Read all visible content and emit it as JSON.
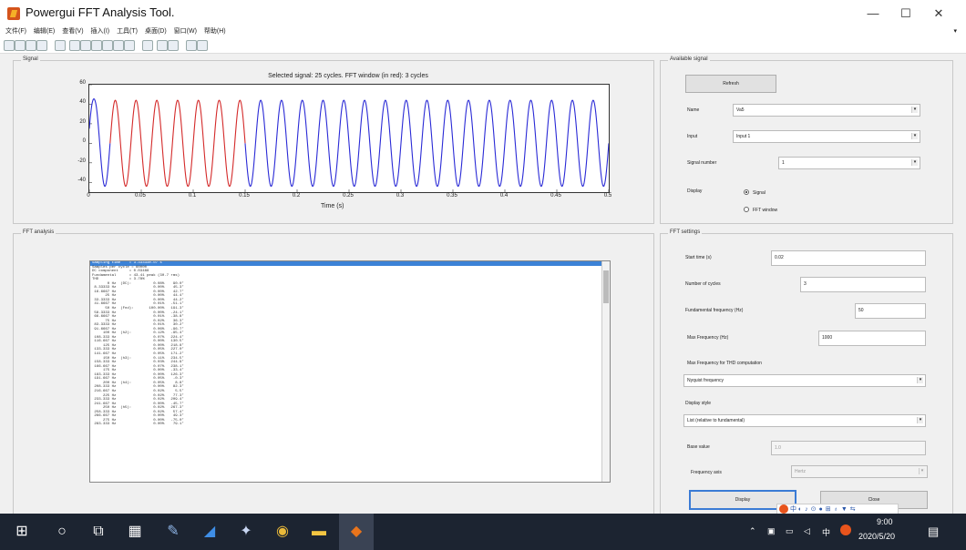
{
  "window": {
    "title": "Powergui FFT Analysis Tool.",
    "controls": [
      "—",
      "☐",
      "✕"
    ]
  },
  "menu": {
    "items": [
      "文件(F)",
      "编辑(E)",
      "查看(V)",
      "插入(I)",
      "工具(T)",
      "桌面(D)",
      "窗口(W)",
      "帮助(H)"
    ]
  },
  "signal_panel": {
    "title": "Signal"
  },
  "chart_data": {
    "type": "line",
    "title": "Selected signal: 25 cycles. FFT window (in red): 3 cycles",
    "xlabel": "Time (s)",
    "ylabel": "",
    "xlim": [
      0,
      0.5
    ],
    "ylim": [
      -50,
      60
    ],
    "xticks": [
      "0",
      "0.05",
      "0.1",
      "0.15",
      "0.2",
      "0.25",
      "0.3",
      "0.35",
      "0.4",
      "0.45",
      "0.5"
    ],
    "yticks": [
      "60",
      "40",
      "20",
      "0",
      "-20",
      "-40"
    ],
    "series": [
      {
        "color": "#d42a2a",
        "description_window": [
          0.02,
          0.15
        ]
      },
      {
        "color": "#2a2ad6"
      }
    ],
    "amplitude": 44,
    "frequency": 50,
    "initial_spike": 60
  },
  "fft_panel": {
    "title": "FFT analysis",
    "lines": [
      "Sampling time    = 3.33333e-07 s",
      "Samples per cycle = 60000",
      "DC component     = 0.03488",
      "Fundamental      = 43.41 peak (30.7 rms)",
      "THD              = 3.78%",
      "",
      "       0 Hz  (DC):          0.08%    90.0°",
      " 8.33333 Hz                 0.00%    45.3°",
      " 16.6667 Hz                 0.00%    42.7°",
      "      25 Hz                 0.00%    44.4°",
      " 33.3333 Hz                 0.00%    44.2°",
      " 41.6667 Hz                 0.01%   -51.1°",
      "      50 Hz  (Fnd):       100.00%   191.3°",
      " 58.3333 Hz                 0.00%   -24.1°",
      " 66.6667 Hz                 0.01%   -38.8°",
      "      75 Hz                 0.02%    36.3°",
      " 83.3333 Hz                 0.01%    30.2°",
      " 91.6667 Hz                 0.06%   -96.7°",
      "     100 Hz  (h2):          0.12%   -95.4°",
      " 108.333 Hz                 0.07%   224.4°",
      " 116.667 Hz                 0.00%   130.5°",
      "     125 Hz                 0.00%   218.8°",
      " 133.333 Hz                 0.05%   227.0°",
      " 141.667 Hz                 0.05%   171.2°",
      "     150 Hz  (h3):          0.11%   234.5°",
      " 158.333 Hz                 0.03%   244.9°",
      " 166.667 Hz                 0.07%   238.1°",
      "     175 Hz                 0.00%   -33.4°",
      " 183.333 Hz                 0.00%   126.3°",
      " 191.667 Hz                 0.05%    -0.3°",
      "     200 Hz  (h4):          0.05%     8.8°",
      " 208.333 Hz                 0.00%    82.3°",
      " 216.667 Hz                 0.02%     5.5°",
      "     225 Hz                 0.02%    77.3°",
      " 233.333 Hz                 0.02%   209.4°",
      " 241.667 Hz                 0.00%   -45.7°",
      "     250 Hz  (h5):          0.02%   267.3°",
      " 258.333 Hz                 0.02%    57.4°",
      " 266.667 Hz                 0.00%    49.3°",
      "     275 Hz                 0.00%   -75.0°",
      " 283.333 Hz                 0.00%    79.1°"
    ]
  },
  "analysis_panel": {
    "title": "Available signal",
    "refresh_label": "Refresh",
    "name_label": "Name",
    "name_value": "Va5",
    "input_label": "Input",
    "input_value": "Input 1",
    "signal_number_label": "Signal number",
    "signal_number_value": "1",
    "display_label": "Display",
    "radio_signal_label": "Signal",
    "radio_fft_label": "FFT window"
  },
  "settings_panel": {
    "title": "FFT settings",
    "start_time_label": "Start time (s)",
    "start_time_value": "0.02",
    "cycles_label": "Number of cycles",
    "cycles_value": "3",
    "fund_freq_label": "Fundamental frequency (Hz)",
    "fund_freq_value": "50",
    "max_freq_label": "Max Frequency (Hz)",
    "max_freq_value": "1000",
    "thd_label": "Max Frequency for THD computation",
    "thd_value": "Nyquist frequency",
    "display_style_label": "Display style",
    "display_style_value": "List (relative to fundamental)",
    "base_value_label": "Base value",
    "base_value_value": "1.0",
    "freq_axis_label": "Frequency axis",
    "freq_axis_value": "Hertz",
    "display_button": "Display",
    "close_button": "Close"
  },
  "taskbar": {
    "time": "9:00",
    "date": "2020/5/20",
    "ime_label": "中"
  }
}
